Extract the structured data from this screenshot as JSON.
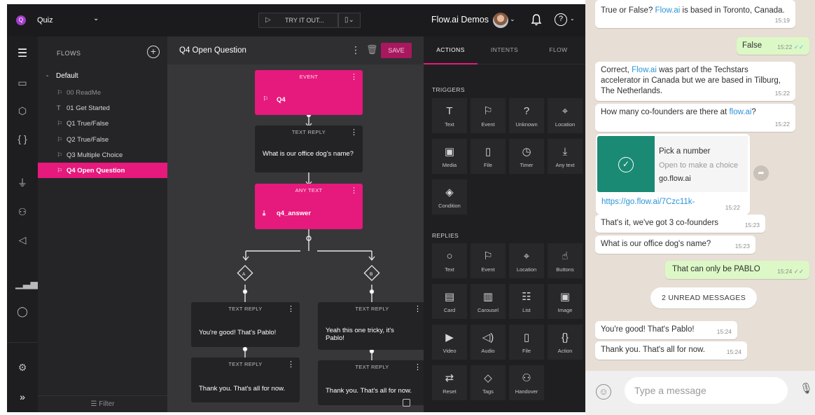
{
  "topbar": {
    "project_badge": "Q",
    "project_name": "Quiz",
    "try_it_label": "TRY IT OUT...",
    "org_name": "Flow.ai Demos"
  },
  "flows_panel": {
    "heading": "FLOWS",
    "group": "Default",
    "items": [
      {
        "icon": "⚐",
        "label": "00 ReadMe",
        "muted": true
      },
      {
        "icon": "T",
        "label": "01 Get Started"
      },
      {
        "icon": "⚐",
        "label": "Q1 True/False"
      },
      {
        "icon": "⚐",
        "label": "Q2 True/False"
      },
      {
        "icon": "⚐",
        "label": "Q3 Multiple Choice"
      },
      {
        "icon": "⚐",
        "label": "Q4 Open Question",
        "active": true
      }
    ],
    "filter_label": "Filter"
  },
  "canvas": {
    "title": "Q4 Open Question",
    "save_label": "SAVE",
    "nodes": {
      "event": {
        "type": "EVENT",
        "text": "Q4"
      },
      "reply1": {
        "type": "TEXT REPLY",
        "text": "What is our office dog's name?"
      },
      "anytext": {
        "type": "ANY TEXT",
        "text": "q4_answer"
      },
      "branch_a": "A",
      "branch_b": "B",
      "reply_a1": {
        "type": "TEXT REPLY",
        "text": "You're good! That's Pablo!"
      },
      "reply_a2": {
        "type": "TEXT REPLY",
        "text": "Thank you. That's all for now."
      },
      "reply_b1": {
        "type": "TEXT REPLY",
        "text": "Yeah this one tricky, it's Pablo!"
      },
      "reply_b2": {
        "type": "TEXT REPLY",
        "text": "Thank you. That's all for now."
      }
    }
  },
  "right_panel": {
    "tabs": [
      "ACTIONS",
      "INTENTS",
      "FLOW"
    ],
    "triggers_heading": "TRIGGERS",
    "triggers": [
      {
        "icon": "T",
        "label": "Text"
      },
      {
        "icon": "⚐",
        "label": "Event"
      },
      {
        "icon": "?",
        "label": "Unknown"
      },
      {
        "icon": "⌖",
        "label": "Location"
      },
      {
        "icon": "▣",
        "label": "Media"
      },
      {
        "icon": "▯",
        "label": "File"
      },
      {
        "icon": "◷",
        "label": "Timer"
      },
      {
        "icon": "⤓",
        "label": "Any text"
      },
      {
        "icon": "◈",
        "label": "Condition"
      }
    ],
    "replies_heading": "REPLIES",
    "replies": [
      {
        "icon": "○",
        "label": "Text"
      },
      {
        "icon": "⚐",
        "label": "Event"
      },
      {
        "icon": "⌖",
        "label": "Location"
      },
      {
        "icon": "☝",
        "label": "Buttons"
      },
      {
        "icon": "▤",
        "label": "Card"
      },
      {
        "icon": "▥",
        "label": "Carousel"
      },
      {
        "icon": "☷",
        "label": "List"
      },
      {
        "icon": "▣",
        "label": "Image"
      },
      {
        "icon": "▶",
        "label": "Video"
      },
      {
        "icon": "◁)",
        "label": "Audio"
      },
      {
        "icon": "▯",
        "label": "File"
      },
      {
        "icon": "{}",
        "label": "Action"
      },
      {
        "icon": "⇄",
        "label": "Reset"
      },
      {
        "icon": "◇",
        "label": "Tags"
      },
      {
        "icon": "⚇",
        "label": "Handover"
      }
    ]
  },
  "chat": {
    "m1_pre": "True or False? ",
    "m1_link": "Flow.ai",
    "m1_post": " is based in Toronto, Canada.",
    "m1_time": "15:19",
    "m2_text": "False",
    "m2_time": "15:22",
    "m3_pre": "Correct, ",
    "m3_link": "Flow.ai",
    "m3_post": " was part of the Techstars accelerator in Canada but we are based in Tilburg, The Netherlands.",
    "m3_time": "15:22",
    "m4_pre": "How many co-founders are there at ",
    "m4_link": "flow.ai",
    "m4_post": "?",
    "m4_time": "15:22",
    "card_title": "Pick a number",
    "card_sub": "Open to make a choice",
    "card_domain": "go.flow.ai",
    "card_link": "https://go.flow.ai/7Czc11k-",
    "card_time": "15:22",
    "m6_text": "That's it, we've got 3 co-founders",
    "m6_time": "15:23",
    "m7_text": "What is our office dog's name?",
    "m7_time": "15:23",
    "m8_text": "That can only be PABLO",
    "m8_time": "15:24",
    "unread_label": "2 UNREAD MESSAGES",
    "m9_text": "You're good! That's Pablo!",
    "m9_time": "15:24",
    "m10_text": "Thank you. That's all for now.",
    "m10_time": "15:24",
    "input_placeholder": "Type a message"
  },
  "colors": {
    "accent": "#e6197c",
    "wa_out_bubble": "#dcf8c6",
    "wa_link": "#2b95d6"
  }
}
